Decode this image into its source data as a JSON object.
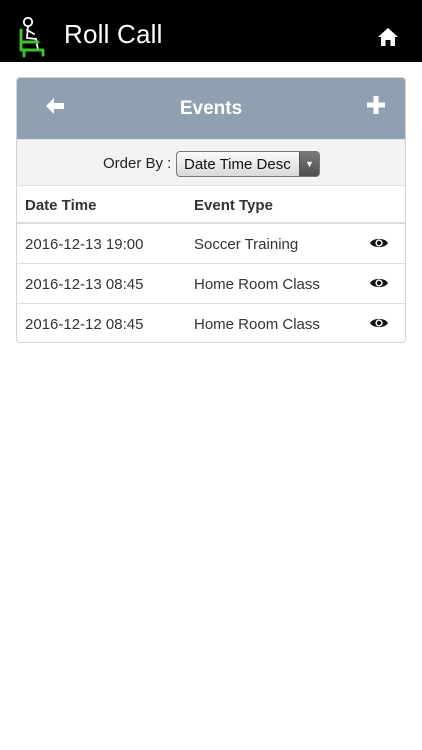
{
  "app": {
    "title": "Roll Call",
    "logo_icon": "person-in-chair-logo",
    "home_icon": "home-icon"
  },
  "colors": {
    "topbar": "#000000",
    "panel_header": "#8fa0b0",
    "logo_green": "#3ec02f"
  },
  "panel": {
    "title": "Events",
    "back_icon": "arrow-left-icon",
    "add_icon": "plus-icon"
  },
  "order": {
    "label": "Order By :",
    "selected": "Date Time Desc"
  },
  "table": {
    "columns": [
      "Date Time",
      "Event Type"
    ],
    "rows": [
      {
        "date_time": "2016-12-13 19:00",
        "event_type": "Soccer Training",
        "action_icon": "eye-icon"
      },
      {
        "date_time": "2016-12-13 08:45",
        "event_type": "Home Room Class",
        "action_icon": "eye-icon"
      },
      {
        "date_time": "2016-12-12 08:45",
        "event_type": "Home Room Class",
        "action_icon": "eye-icon"
      }
    ]
  }
}
